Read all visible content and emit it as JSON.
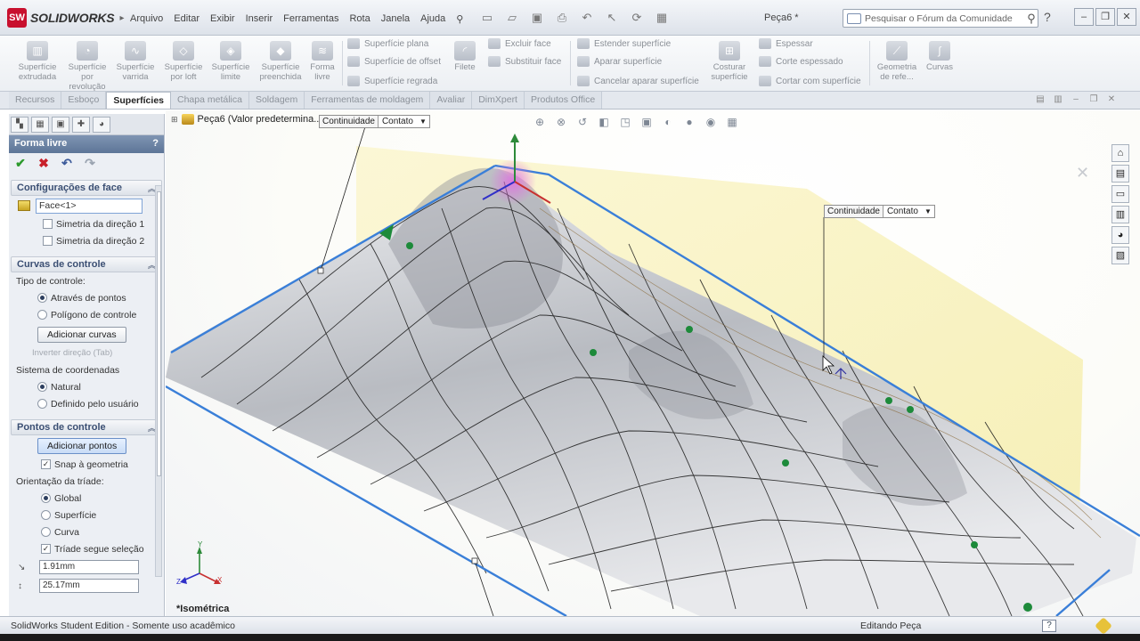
{
  "app": {
    "logo": "SOLIDWORKS",
    "logo_mark": "SW",
    "document_title": "Peça6 *"
  },
  "menu": [
    "Arquivo",
    "Editar",
    "Exibir",
    "Inserir",
    "Ferramentas",
    "Rota",
    "Janela",
    "Ajuda"
  ],
  "search": {
    "placeholder": "Pesquisar o Fórum da Comunidade"
  },
  "ribbon": {
    "big_buttons": [
      {
        "label": "Superfície extrudada"
      },
      {
        "label": "Superfície por revolução"
      },
      {
        "label": "Superfície varrida"
      },
      {
        "label": "Superfície por loft"
      },
      {
        "label": "Superfície limite"
      },
      {
        "label": "Superfície preenchida"
      },
      {
        "label": "Forma livre"
      }
    ],
    "col1": [
      "Superfície plana",
      "Superfície de offset",
      "Superfície regrada"
    ],
    "filete": "Filete",
    "col2": [
      "Excluir face",
      "Substituir face"
    ],
    "col3": [
      "Estender superfície",
      "Aparar superfície",
      "Cancelar aparar superfície"
    ],
    "costurar": "Costurar superfície",
    "col4": [
      "Espessar",
      "Corte espessado",
      "Cortar com superfície"
    ],
    "geometria": "Geometria de refe...",
    "curvas": "Curvas"
  },
  "tabs": [
    {
      "label": "Recursos",
      "active": false
    },
    {
      "label": "Esboço",
      "active": false
    },
    {
      "label": "Superfícies",
      "active": true
    },
    {
      "label": "Chapa metálica",
      "active": false
    },
    {
      "label": "Soldagem",
      "active": false
    },
    {
      "label": "Ferramentas de moldagem",
      "active": false
    },
    {
      "label": "Avaliar",
      "active": false
    },
    {
      "label": "DimXpert",
      "active": false
    },
    {
      "label": "Produtos Office",
      "active": false
    }
  ],
  "property_manager": {
    "title": "Forma livre",
    "face_settings": {
      "header": "Configurações de face",
      "face_value": "Face<1>",
      "sym1": "Simetria da direção 1",
      "sym2": "Simetria da direção 2"
    },
    "control_curves": {
      "header": "Curvas de controle",
      "type_label": "Tipo de controle:",
      "opt1": "Através de pontos",
      "opt2": "Polígono de controle",
      "add_curves": "Adicionar curvas",
      "invert": "Inverter direção (Tab)",
      "coord_label": "Sistema de coordenadas",
      "coord1": "Natural",
      "coord2": "Definido pelo usuário"
    },
    "control_points": {
      "header": "Pontos de controle",
      "add_points": "Adicionar pontos",
      "snap": "Snap à geometria",
      "triad_label": "Orientação da tríade:",
      "t1": "Global",
      "t2": "Superfície",
      "t3": "Curva",
      "follow": "Tríade segue seleção",
      "val1": "1.91mm",
      "val2": "25.17mm"
    }
  },
  "viewport": {
    "breadcrumb": "Peça6  (Valor predetermina...",
    "callout1": {
      "label": "Continuidade",
      "value": "Contato"
    },
    "callout2": {
      "label": "Continuidade",
      "value": "Contato"
    },
    "view_name": "*Isométrica",
    "triad": {
      "x": "X",
      "y": "Y",
      "z": "Z"
    }
  },
  "status": {
    "left": "SolidWorks Student Edition - Somente uso acadêmico",
    "right": "Editando Peça"
  },
  "colors": {
    "edge_blue": "#3a7fd8",
    "plane_yellow": "#f6f0b0",
    "point_green": "#1d8a3a",
    "title_blue": "#5d7597"
  }
}
